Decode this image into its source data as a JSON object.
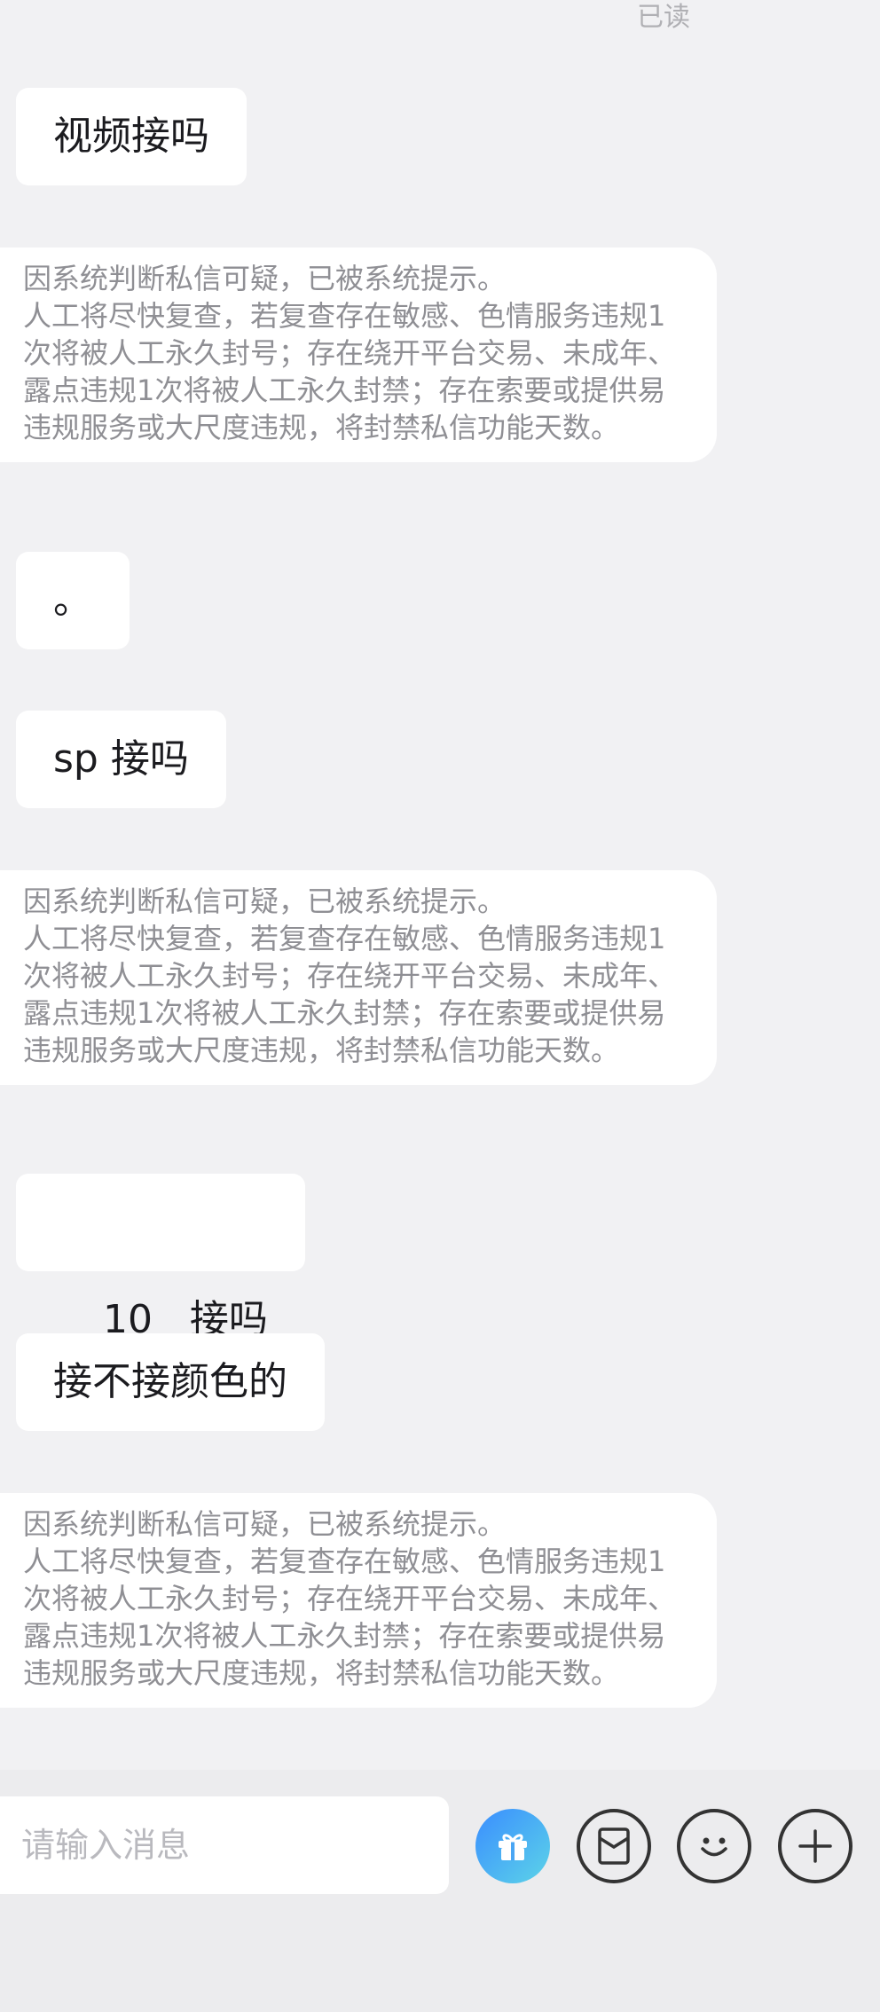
{
  "status": {
    "read": "已读"
  },
  "messages": [
    {
      "type": "user",
      "text": "视频接吗"
    },
    {
      "type": "system",
      "line1": "因系统判断私信可疑，已被系统提示。",
      "line2": "人工将尽快复查，若复查存在敏感、色情服务违规1次将被人工永久封号；存在绕开平台交易、未成年、露点违规1次将被人工永久封禁；存在索要或提供易违规服务或大尺度违规，将封禁私信功能天数。"
    },
    {
      "type": "user",
      "text": "。"
    },
    {
      "type": "user",
      "text": "sp 接吗"
    },
    {
      "type": "system",
      "line1": "因系统判断私信可疑，已被系统提示。",
      "line2": "人工将尽快复查，若复查存在敏感、色情服务违规1次将被人工永久封号；存在绕开平台交易、未成年、露点违规1次将被人工永久封禁；存在索要或提供易违规服务或大尺度违规，将封禁私信功能天数。"
    },
    {
      "type": "user",
      "text": "10   接吗"
    },
    {
      "type": "user",
      "text": "接不接颜色的"
    },
    {
      "type": "system",
      "line1": "因系统判断私信可疑，已被系统提示。",
      "line2": "人工将尽快复查，若复查存在敏感、色情服务违规1次将被人工永久封号；存在绕开平台交易、未成年、露点违规1次将被人工永久封禁；存在索要或提供易违规服务或大尺度违规，将封禁私信功能天数。"
    }
  ],
  "input": {
    "placeholder": "请输入消息",
    "value": ""
  },
  "toolbar": {
    "gift_icon": "gift-icon",
    "redpacket_icon": "red-packet-icon",
    "emoji_icon": "smiley-icon",
    "more_icon": "plus-icon"
  },
  "colors": {
    "gift_gradient_start": "#3a8dff",
    "gift_gradient_end": "#5cd4e8",
    "background": "#f1f1f3"
  }
}
